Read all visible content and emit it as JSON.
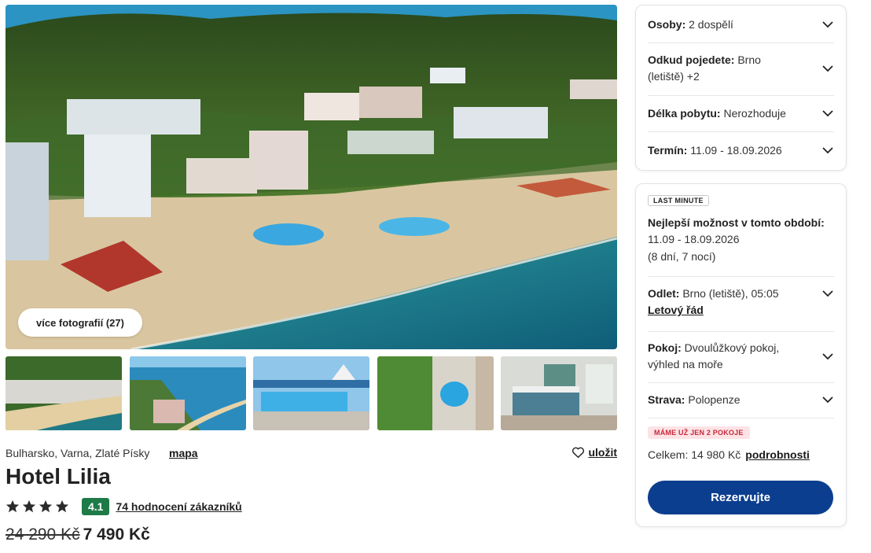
{
  "gallery": {
    "more_photos_label": "více fotografií (27)",
    "thumbnails": [
      "beach-resort-aerial",
      "coast-aerial",
      "pool-terrace",
      "pool-garden",
      "hotel-room"
    ]
  },
  "hotel": {
    "location": "Bulharsko, Varna, Zlaté Písky",
    "map_label": "mapa",
    "save_label": "uložit",
    "name": "Hotel Lilia",
    "stars": 4,
    "score": "4.1",
    "reviews_label": "74 hodnocení zákazníků",
    "old_price": "24 290 Kč",
    "price": "7 490 Kč"
  },
  "filters": {
    "persons_label": "Osoby:",
    "persons_value": "2 dospělí",
    "departure_label": "Odkud pojedete:",
    "departure_value": "Brno",
    "departure_value_2": "(letiště) +2",
    "length_label": "Délka pobytu:",
    "length_value": "Nerozhoduje",
    "term_label": "Termín:",
    "term_value": "11.09 - 18.09.2026"
  },
  "offer": {
    "badge": "LAST MINUTE",
    "best_title": "Nejlepší možnost v tomto období:",
    "best_dates": "11.09 - 18.09.2026",
    "best_nights": "(8 dní, 7 nocí)",
    "flight_label": "Odlet:",
    "flight_value": "Brno (letiště), 05:05",
    "flight_link": "Letový řád",
    "room_label": "Pokoj:",
    "room_value": "Dvoulůžkový pokoj,",
    "room_value_2": "výhled na moře",
    "board_label": "Strava:",
    "board_value": "Polopenze",
    "rooms_badge": "MÁME UŽ JEN 2 POKOJE",
    "total_label": "Celkem: 14 980 Kč",
    "details_link": "podrobnosti",
    "reserve_label": "Rezervujte"
  },
  "colors": {
    "accent": "#0b3e8f",
    "score_green": "#1e7a46",
    "badge_red": "#c8283a"
  },
  "icons": [
    "heart-icon",
    "star-icon",
    "chevron-down-icon"
  ]
}
